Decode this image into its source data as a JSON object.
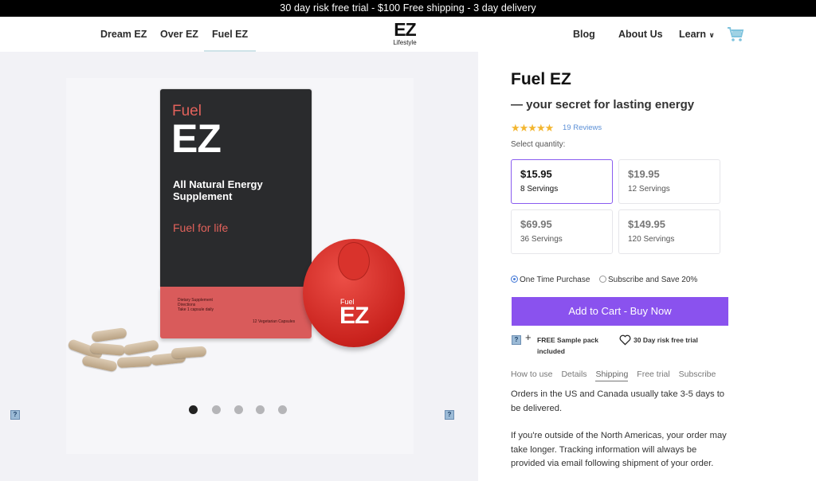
{
  "promo": "30 day risk free trial - $100 Free shipping - 3 day delivery",
  "nav": {
    "left": [
      "Dream EZ",
      "Over EZ",
      "Fuel EZ"
    ],
    "logo_mark": "EZ",
    "logo_sub": "Lifestyle",
    "right": [
      "Blog",
      "About Us",
      "Learn"
    ]
  },
  "gallery": {
    "box": {
      "brand_small": "Fuel",
      "brand_big": "EZ",
      "headline": "All Natural Energy Supplement",
      "slogan": "Fuel for life",
      "dietary": "Dietary Supplement",
      "directions": "Directions",
      "dose": "Take 1 capsule daily",
      "capsules": "12 Vegetarian Capsules"
    },
    "jar": {
      "small": "Fuel",
      "big": "EZ"
    },
    "dots": 5,
    "active_dot": 0
  },
  "product": {
    "title": "Fuel EZ",
    "subtitle": "— your secret for lasting energy",
    "stars": "★★★★★",
    "reviews": "19 Reviews",
    "select_label": "Select quantity:",
    "options": [
      {
        "price": "$15.95",
        "servings": "8 Servings"
      },
      {
        "price": "$19.95",
        "servings": "12 Servings"
      },
      {
        "price": "$69.95",
        "servings": "36 Servings"
      },
      {
        "price": "$149.95",
        "servings": "120 Servings"
      }
    ],
    "purchase": {
      "one_time": "One Time Purchase",
      "subscribe": "Subscribe and Save 20%"
    },
    "cta": "Add to Cart - Buy Now",
    "perk_sample": "FREE Sample pack included",
    "perk_trial": "30 Day risk free trial",
    "tabs": [
      "How to use",
      "Details",
      "Shipping",
      "Free trial",
      "Subscribe"
    ],
    "shipping_p1": "Orders in the US and Canada usually take 3-5 days to be delivered.",
    "shipping_p2": "If you're outside of the North Americas, your order may take longer. Tracking information will always be provided via email following shipment of your order."
  },
  "colors": {
    "accent": "#8a52ee",
    "star": "#f3b630",
    "link": "#5b8fd6",
    "cart": "#7fc3dd"
  }
}
